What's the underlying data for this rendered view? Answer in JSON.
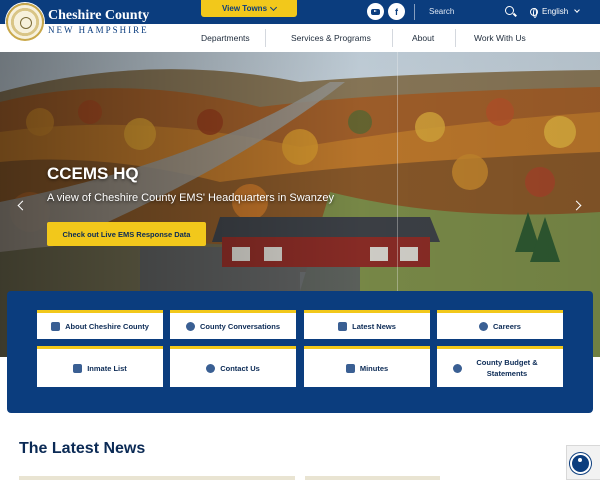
{
  "brand": {
    "title": "Cheshire County",
    "subtitle": "NEW HAMPSHIRE"
  },
  "topbar": {
    "view_towns": "View Towns",
    "search_placeholder": "Search",
    "language": "English",
    "social_facebook": "f"
  },
  "nav": {
    "items": [
      "Departments",
      "Services & Programs",
      "About",
      "Work With Us"
    ]
  },
  "hero": {
    "title": "CCEMS HQ",
    "subtitle": "A view of Cheshire County EMS' Headquarters in Swanzey",
    "button": "Check out Live EMS Response Data"
  },
  "quick_links": [
    {
      "label": "About Cheshire County",
      "icon": "shield-icon"
    },
    {
      "label": "County Conversations",
      "icon": "chat-icon"
    },
    {
      "label": "Latest News",
      "icon": "newspaper-icon"
    },
    {
      "label": "Careers",
      "icon": "people-icon"
    },
    {
      "label": "Inmate List",
      "icon": "building-icon"
    },
    {
      "label": "Contact Us",
      "icon": "phone-icon"
    },
    {
      "label": "Minutes",
      "icon": "document-icon"
    },
    {
      "label": "County Budget & Statements",
      "icon": "search-dollar-icon"
    }
  ],
  "news": {
    "heading": "The Latest News"
  },
  "colors": {
    "primary": "#0b3d7e",
    "accent": "#f2c81b"
  }
}
